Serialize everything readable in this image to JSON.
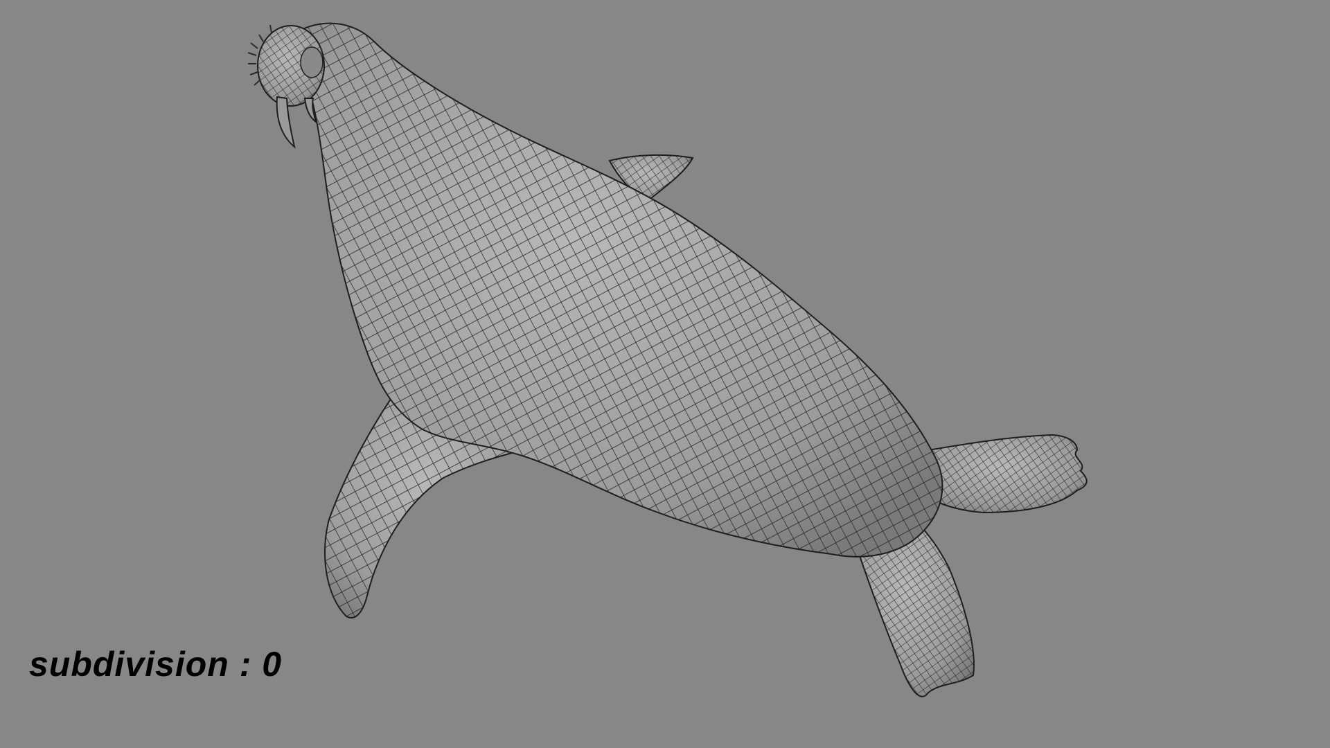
{
  "viewport": {
    "background_color": "#878787",
    "subdivision_label": "subdivision : 0"
  },
  "model": {
    "name": "walrus-wireframe",
    "surface_color": "#a3a3a3",
    "wire_color": "#1e1e1e"
  }
}
